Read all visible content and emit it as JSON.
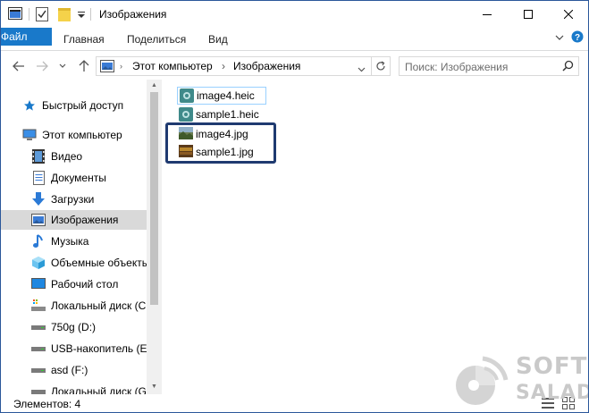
{
  "window": {
    "title": "Изображения",
    "accent": "#1979ca"
  },
  "ribbon": {
    "tabs": [
      {
        "label": "Файл"
      },
      {
        "label": "Главная"
      },
      {
        "label": "Поделиться"
      },
      {
        "label": "Вид"
      }
    ]
  },
  "address": {
    "crumbs": [
      "Этот компьютер",
      "Изображения"
    ],
    "search_placeholder": "Поиск: Изображения"
  },
  "nav": {
    "items": [
      {
        "label": "Быстрый доступ",
        "icon": "star-icon"
      },
      {
        "label": "Этот компьютер",
        "icon": "computer-icon"
      },
      {
        "label": "Видео",
        "icon": "video-icon"
      },
      {
        "label": "Документы",
        "icon": "documents-icon"
      },
      {
        "label": "Загрузки",
        "icon": "downloads-icon"
      },
      {
        "label": "Изображения",
        "icon": "pictures-icon",
        "selected": true
      },
      {
        "label": "Музыка",
        "icon": "music-icon"
      },
      {
        "label": "Объемные объекты",
        "icon": "3d-objects-icon"
      },
      {
        "label": "Рабочий стол",
        "icon": "desktop-icon"
      },
      {
        "label": "Локальный диск (C:",
        "icon": "drive-c-icon"
      },
      {
        "label": "750g (D:)",
        "icon": "drive-icon"
      },
      {
        "label": "USB-накопитель (E:)",
        "icon": "usb-drive-icon"
      },
      {
        "label": "asd (F:)",
        "icon": "drive-icon"
      },
      {
        "label": "Локальный диск (G:",
        "icon": "drive-icon"
      }
    ]
  },
  "files": [
    {
      "name": "image4.heic",
      "icon": "heic-file-icon"
    },
    {
      "name": "sample1.heic",
      "icon": "heic-file-icon"
    },
    {
      "name": "image4.jpg",
      "icon": "jpg-file-icon"
    },
    {
      "name": "sample1.jpg",
      "icon": "jpg-file-icon"
    }
  ],
  "status": {
    "items_count": "Элементов: 4"
  },
  "watermark": {
    "line1": "SOFT",
    "line2": "SALAD"
  }
}
